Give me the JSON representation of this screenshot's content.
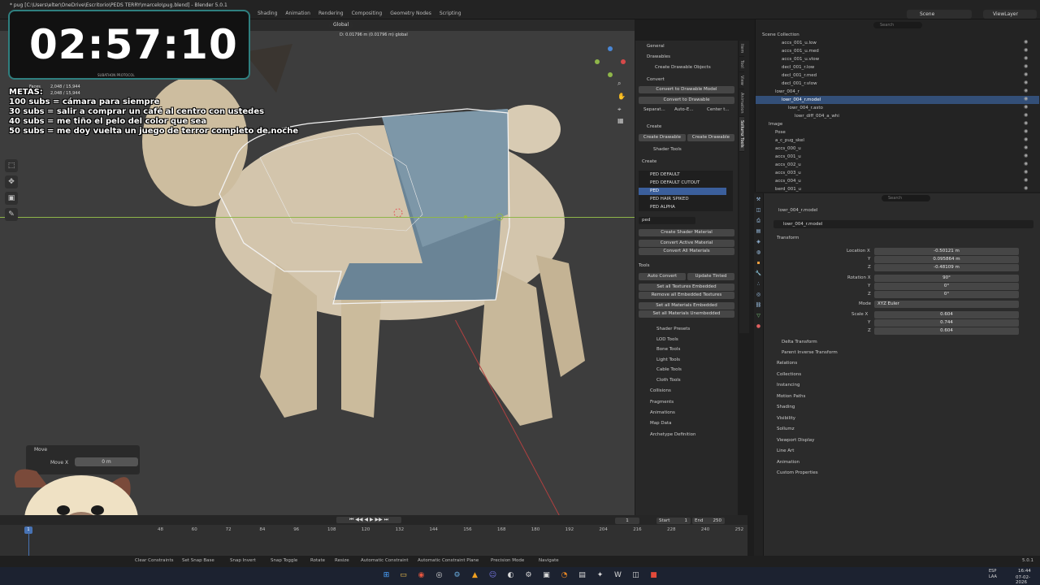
{
  "window": {
    "title": "* pug [C:\\Users\\elter\\OneDrive\\Escritorio\\PEDS TERRY\\marcelo\\pug.blend] - Blender 5.0.1"
  },
  "workspaces": [
    "Shading",
    "Animation",
    "Rendering",
    "Compositing",
    "Geometry Nodes",
    "Scripting"
  ],
  "scene": {
    "name": "Scene",
    "view_layer": "ViewLayer"
  },
  "viewport": {
    "orientation": "Global",
    "pivot_readout": "D: 0.01796 m (0.01796 m) global",
    "mesh_stats_1": "2,048 / 15,944",
    "mesh_stats_2": "2,048 / 15,944",
    "stats_label": "Faces"
  },
  "overlay": {
    "timer": "02:57:10",
    "timer_sub": "SUBATHON PROTOCOL",
    "goals_title": "METAS:",
    "goals": [
      "100 subs = cámara para siempre",
      "30 subs = salir a comprar un café al centro con ustedes",
      "40 subs = me tiño el pelo del color que sea",
      "50 subs = me doy vuelta un juego de terror completo de noche"
    ]
  },
  "move_panel": {
    "title": "Move",
    "label": "Move X",
    "value": "0 m"
  },
  "npanel": {
    "tabs": [
      "Item",
      "Tool",
      "View",
      "Animation",
      "Sollumz Tools"
    ],
    "general": "General",
    "drawables": "Drawables",
    "create_drawable_objects": "Create Drawable Objects",
    "convert_header": "Convert",
    "convert_to_drawable_model": "Convert to Drawable Model",
    "convert_to_drawable": "Convert to Drawable",
    "separate": "Separat...",
    "auto_embed": "Auto-E...",
    "center": "Center t...",
    "create_header": "Create",
    "create_drawable": "Create Drawable",
    "create_drawable2": "Create Drawable",
    "shader_tools": "Shader Tools",
    "create_label": "Create",
    "shader_list": [
      "PED DEFAULT",
      "PED DEFAULT CUTOUT",
      "PED",
      "PED HAIR SPIKED",
      "PED ALPHA"
    ],
    "shader_selected_index": 2,
    "search_value": "ped",
    "create_shader_material": "Create Shader Material",
    "convert_active_material": "Convert Active Material",
    "convert_all_materials": "Convert All Materials",
    "tools_header": "Tools",
    "auto_convert": "Auto Convert",
    "update_tinted": "Update Tinted",
    "set_all_textures_embedded": "Set all Textures Embedded",
    "remove_all_embedded_textures": "Remove all Embedded Textures",
    "set_all_materials_embedded": "Set all Materials Embedded",
    "set_all_materials_unembedded": "Set all Materials Unembedded",
    "subsections": [
      "Shader Presets",
      "LOD Tools",
      "Bone Tools",
      "Light Tools",
      "Cable Tools",
      "Cloth Tools"
    ],
    "bottom_sections": [
      "Collisions",
      "Fragments",
      "Animations",
      "Map Data",
      "Archetype Definition"
    ]
  },
  "outliner": {
    "search_placeholder": "Search",
    "root": "Scene Collection",
    "rows": [
      {
        "label": "accs_001_u.low",
        "indent": 3,
        "selected": false
      },
      {
        "label": "accs_001_u.med",
        "indent": 3,
        "selected": false
      },
      {
        "label": "accs_001_u.vlow",
        "indent": 3,
        "selected": false
      },
      {
        "label": "decl_001_r.low",
        "indent": 3,
        "selected": false
      },
      {
        "label": "decl_001_r.med",
        "indent": 3,
        "selected": false
      },
      {
        "label": "decl_001_r.vlow",
        "indent": 3,
        "selected": false
      },
      {
        "label": "lowr_004_r",
        "indent": 2,
        "selected": false
      },
      {
        "label": "lowr_004_r.model",
        "indent": 3,
        "selected": true
      },
      {
        "label": "lowr_004_r.asto",
        "indent": 4,
        "selected": false
      },
      {
        "label": "lowr_diff_004_a_whi",
        "indent": 5,
        "selected": false
      },
      {
        "label": "Image",
        "indent": 1,
        "selected": false
      },
      {
        "label": "Pose",
        "indent": 2,
        "selected": false
      },
      {
        "label": "a_c_pug_skel",
        "indent": 2,
        "selected": false
      },
      {
        "label": "accs_000_u",
        "indent": 2,
        "selected": false
      },
      {
        "label": "accs_001_u",
        "indent": 2,
        "selected": false
      },
      {
        "label": "accs_002_u",
        "indent": 2,
        "selected": false
      },
      {
        "label": "accs_003_u",
        "indent": 2,
        "selected": false
      },
      {
        "label": "accs_004_u",
        "indent": 2,
        "selected": false
      },
      {
        "label": "berd_001_u",
        "indent": 2,
        "selected": false
      }
    ]
  },
  "properties": {
    "search_placeholder": "Search",
    "object_name": "lowr_004_r.model",
    "object_field": "lowr_004_r.model",
    "transform": "Transform",
    "location_label": "Location X",
    "location": [
      "-0.50121 m",
      "0.095864 m",
      "-0.48109 m"
    ],
    "rotation_label": "Rotation X",
    "rotation": [
      "90°",
      "0°",
      "0°"
    ],
    "mode_label": "Mode",
    "mode_value": "XYZ Euler",
    "scale_label": "Scale X",
    "scale": [
      "0.604",
      "0.744",
      "0.604"
    ],
    "y_label": "Y",
    "z_label": "Z",
    "delta_transform": "Delta Transform",
    "parent_inverse": "Parent Inverse Transform",
    "sections": [
      "Relations",
      "Collections",
      "Instancing",
      "Motion Paths",
      "Shading",
      "Visibility",
      "Sollumz",
      "Viewport Display",
      "Line Art",
      "Animation",
      "Custom Properties"
    ]
  },
  "timeline": {
    "current_frame": "1",
    "start_label": "Start",
    "start_value": "1",
    "end_label": "End",
    "end_value": "250",
    "playhead": "1",
    "frames": [
      "48",
      "60",
      "72",
      "84",
      "96",
      "108",
      "120",
      "132",
      "144",
      "156",
      "168",
      "180",
      "192",
      "204",
      "216",
      "228",
      "240",
      "252"
    ]
  },
  "statusbar": {
    "items": [
      "Clear Constraints",
      "Set Snap Base",
      "Snap Invert",
      "Snap Toggle",
      "Rotate",
      "Resize",
      "Automatic Constraint",
      "Automatic Constraint Plane",
      "Precision Mode",
      "Navigate"
    ],
    "version": "5.0.1"
  },
  "taskbar": {
    "lang_1": "ESP",
    "lang_2": "LAA",
    "time": "16:44",
    "date": "07-02-2026"
  },
  "colors": {
    "accent": "#4772b3",
    "selection": "#334f78",
    "horizon": "#8fb64a",
    "timer_border": "#2f7f7f"
  }
}
